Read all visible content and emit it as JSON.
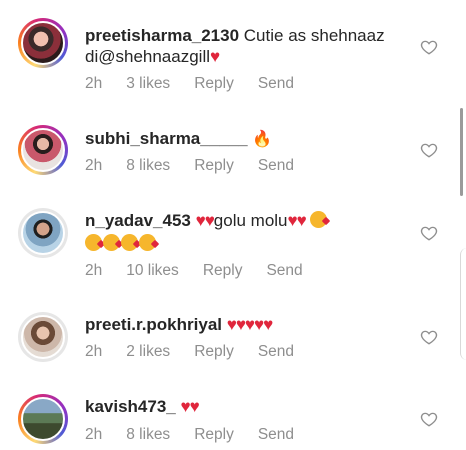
{
  "comments": [
    {
      "username": "preetisharma_2130",
      "text": "Cutie as shehnaaz",
      "text2": "di@shehnaazgill",
      "time": "2h",
      "likes": "3 likes",
      "reply": "Reply",
      "send": "Send"
    },
    {
      "username": "subhi_sharma_____",
      "text": "",
      "time": "2h",
      "likes": "8 likes",
      "reply": "Reply",
      "send": "Send"
    },
    {
      "username": "n_yadav_453",
      "text": "golu molu",
      "time": "2h",
      "likes": "10 likes",
      "reply": "Reply",
      "send": "Send"
    },
    {
      "username": "preeti.r.pokhriyal",
      "text": "",
      "time": "2h",
      "likes": "2 likes",
      "reply": "Reply",
      "send": "Send"
    },
    {
      "username": "kavish473_",
      "text": "",
      "time": "2h",
      "likes": "8 likes",
      "reply": "Reply",
      "send": "Send"
    }
  ],
  "icons": {
    "like": "heart-outline-icon",
    "heart_emoji": "red-heart-emoji",
    "kiss_emoji": "face-blowing-kiss-emoji",
    "fire_emoji": "fire-emoji"
  },
  "colors": {
    "username": "#262626",
    "meta": "#8e8e8e",
    "heart": "#e0263c"
  }
}
